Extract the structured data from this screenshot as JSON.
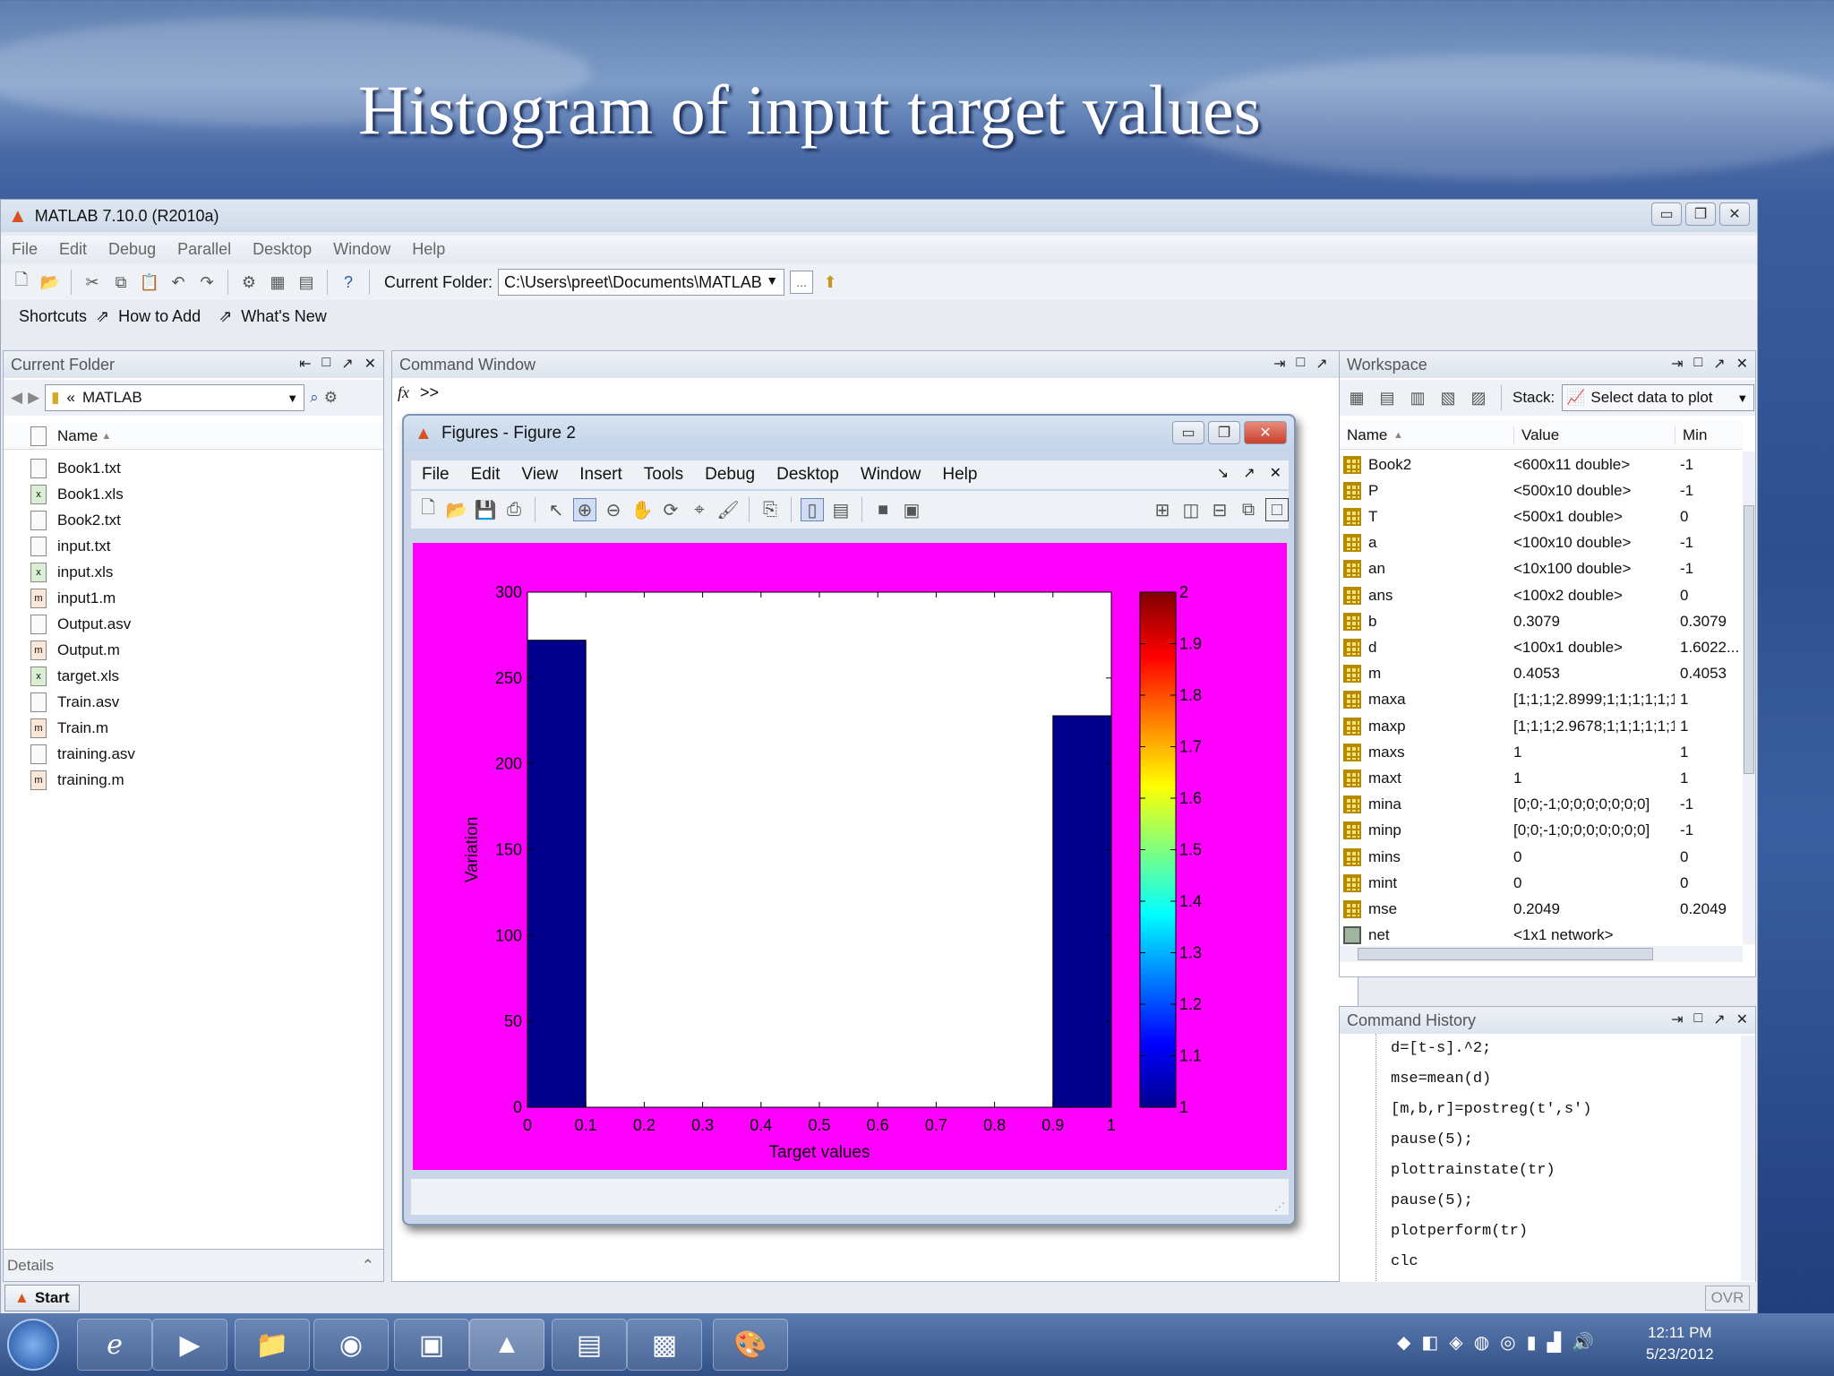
{
  "slide": {
    "title": "Histogram of input target values"
  },
  "window": {
    "title": "MATLAB  7.10.0 (R2010a)"
  },
  "menu": [
    "File",
    "Edit",
    "Debug",
    "Parallel",
    "Desktop",
    "Window",
    "Help"
  ],
  "toolbar": {
    "current_folder_label": "Current Folder:",
    "current_folder_value": "C:\\Users\\preet\\Documents\\MATLAB",
    "browse_label": "..."
  },
  "shortcuts": {
    "shortcuts": "Shortcuts",
    "how_to_add": "How to Add",
    "whats_new": "What's New"
  },
  "current_folder": {
    "title": "Current Folder",
    "address": "MATLAB",
    "column_name": "Name",
    "files": [
      "Book1.txt",
      "Book1.xls",
      "Book2.txt",
      "input.txt",
      "input.xls",
      "input1.m",
      "Output.asv",
      "Output.m",
      "target.xls",
      "Train.asv",
      "Train.m",
      "training.asv",
      "training.m"
    ],
    "details": "Details"
  },
  "command_window": {
    "title": "Command Window",
    "fx": "fx",
    "prompt": ">>"
  },
  "figure": {
    "title": "Figures - Figure 2",
    "menu": [
      "File",
      "Edit",
      "View",
      "Insert",
      "Tools",
      "Debug",
      "Desktop",
      "Window",
      "Help"
    ]
  },
  "chart_data": {
    "type": "bar",
    "title": "",
    "xlabel": "Target values",
    "ylabel": "Variation",
    "xlim": [
      0,
      1
    ],
    "ylim": [
      0,
      300
    ],
    "xticks": [
      "0",
      "0.1",
      "0.2",
      "0.3",
      "0.4",
      "0.5",
      "0.6",
      "0.7",
      "0.8",
      "0.9",
      "1"
    ],
    "yticks": [
      "0",
      "50",
      "100",
      "150",
      "200",
      "250",
      "300"
    ],
    "bins": [
      {
        "x0": 0.0,
        "x1": 0.1,
        "value": 272
      },
      {
        "x0": 0.1,
        "x1": 0.9,
        "value": 0
      },
      {
        "x0": 0.9,
        "x1": 1.0,
        "value": 228
      }
    ],
    "bar_color": "#00008b",
    "background_color": "#ff00ff",
    "colorbar": {
      "range": [
        1,
        2
      ],
      "ticks": [
        "2",
        "1.9",
        "1.8",
        "1.7",
        "1.6",
        "1.5",
        "1.4",
        "1.3",
        "1.2",
        "1.1",
        "1"
      ],
      "colormap": "jet"
    }
  },
  "workspace": {
    "title": "Workspace",
    "stack_label": "Stack:",
    "plot_select": "Select data to plot",
    "columns": [
      "Name",
      "Value",
      "Min"
    ],
    "rows": [
      {
        "name": "Book2",
        "value": "<600x11 double>",
        "min": "-1"
      },
      {
        "name": "P",
        "value": "<500x10 double>",
        "min": "-1"
      },
      {
        "name": "T",
        "value": "<500x1 double>",
        "min": "0"
      },
      {
        "name": "a",
        "value": "<100x10 double>",
        "min": "-1"
      },
      {
        "name": "an",
        "value": "<10x100 double>",
        "min": "-1"
      },
      {
        "name": "ans",
        "value": "<100x2 double>",
        "min": "0"
      },
      {
        "name": "b",
        "value": "0.3079",
        "min": "0.3079"
      },
      {
        "name": "d",
        "value": "<100x1 double>",
        "min": "1.6022..."
      },
      {
        "name": "m",
        "value": "0.4053",
        "min": "0.4053"
      },
      {
        "name": "maxa",
        "value": "[1;1;1;2.8999;1;1;1;1;1;1]",
        "min": "1"
      },
      {
        "name": "maxp",
        "value": "[1;1;1;2.9678;1;1;1;1;1;1]",
        "min": "1"
      },
      {
        "name": "maxs",
        "value": "1",
        "min": "1"
      },
      {
        "name": "maxt",
        "value": "1",
        "min": "1"
      },
      {
        "name": "mina",
        "value": "[0;0;-1;0;0;0;0;0;0;0]",
        "min": "-1"
      },
      {
        "name": "minp",
        "value": "[0;0;-1;0;0;0;0;0;0;0]",
        "min": "-1"
      },
      {
        "name": "mins",
        "value": "0",
        "min": "0"
      },
      {
        "name": "mint",
        "value": "0",
        "min": "0"
      },
      {
        "name": "mse",
        "value": "0.2049",
        "min": "0.2049"
      },
      {
        "name": "net",
        "value": "<1x1 network>",
        "min": ""
      }
    ]
  },
  "command_history": {
    "title": "Command History",
    "lines": [
      "d=[t-s].^2;",
      "mse=mean(d)",
      "[m,b,r]=postreg(t',s')",
      "pause(5);",
      "plottrainstate(tr)",
      "pause(5);",
      "plotperform(tr)",
      "clc"
    ]
  },
  "status": {
    "start": "Start",
    "ovr": "OVR"
  },
  "taskbar": {
    "time": "12:11 PM",
    "date": "5/23/2012"
  }
}
